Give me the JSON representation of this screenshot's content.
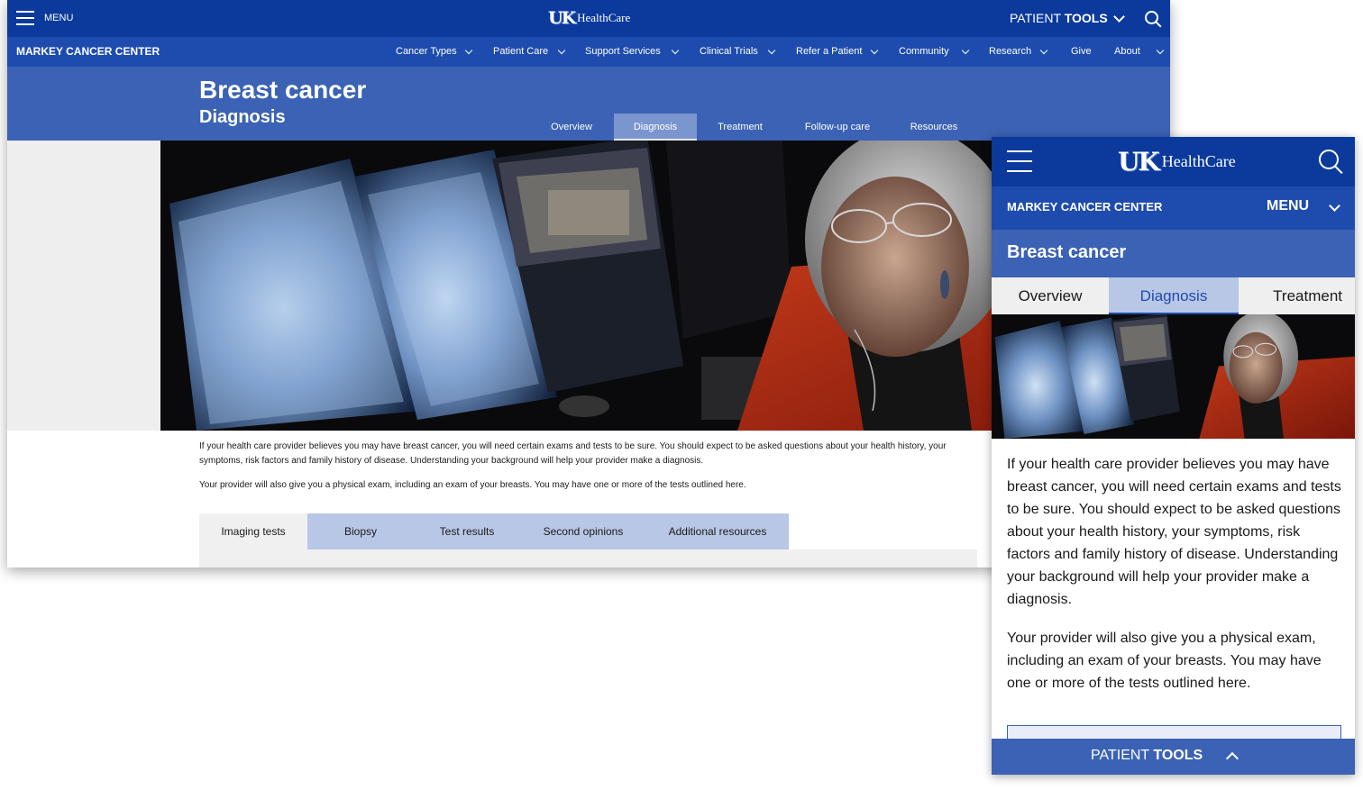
{
  "desktop": {
    "menu_label": "MENU",
    "logo": {
      "mark": "UK",
      "text": "HealthCare"
    },
    "patient_tools": {
      "regular": "PATIENT ",
      "bold": "TOOLS"
    },
    "center_name": "MARKEY CANCER CENTER",
    "nav_items": [
      "Cancer Types",
      "Patient Care",
      "Support Services",
      "Clinical Trials",
      "Refer a Patient",
      "Community",
      "Research",
      "Give",
      "About"
    ],
    "title": "Breast cancer",
    "subtitle": "Diagnosis",
    "tabs": [
      "Overview",
      "Diagnosis",
      "Treatment",
      "Follow-up care",
      "Resources"
    ],
    "active_tab": "Diagnosis",
    "paragraphs": [
      "If your health care provider believes you may have breast cancer, you will need certain exams and tests to be sure. You should expect to be asked questions about your health history, your symptoms, risk factors and family history of disease. Understanding your background will help your provider make a diagnosis.",
      "Your provider will also give you a physical exam, including an exam of your breasts. You may have one or more of the tests outlined here."
    ],
    "subtabs": [
      "Imaging tests",
      "Biopsy",
      "Test results",
      "Second opinions",
      "Additional resources"
    ],
    "active_subtab": "Imaging tests"
  },
  "mobile": {
    "logo": {
      "mark": "UK",
      "text": "HealthCare"
    },
    "center_name": "MARKEY CANCER CENTER",
    "menu_label": "MENU",
    "title": "Breast cancer",
    "tabs": [
      "Overview",
      "Diagnosis",
      "Treatment"
    ],
    "active_tab": "Diagnosis",
    "paragraphs": [
      "If your health care provider believes you may have breast cancer, you will need certain exams and tests to be sure. You should expect to be asked questions about your health history, your symptoms, risk factors and family history of disease. Understanding your background will help your provider make a diagnosis.",
      "Your provider will also give you a physical exam, including an exam of your breasts. You may have one or more of the tests outlined here."
    ],
    "patient_tools": {
      "regular": "PATIENT ",
      "bold": "TOOLS"
    }
  },
  "icons": {
    "menu": "hamburger-icon",
    "search": "search-icon",
    "chevron": "chevron-down-icon",
    "chevron_up": "chevron-up-icon"
  },
  "colors": {
    "top_bar": "#0b3a9c",
    "nav_bar": "#1e4cae",
    "header": "#3b62b4",
    "active_tab": "#7b95cf",
    "subtab_inactive": "#b9c7e6"
  }
}
